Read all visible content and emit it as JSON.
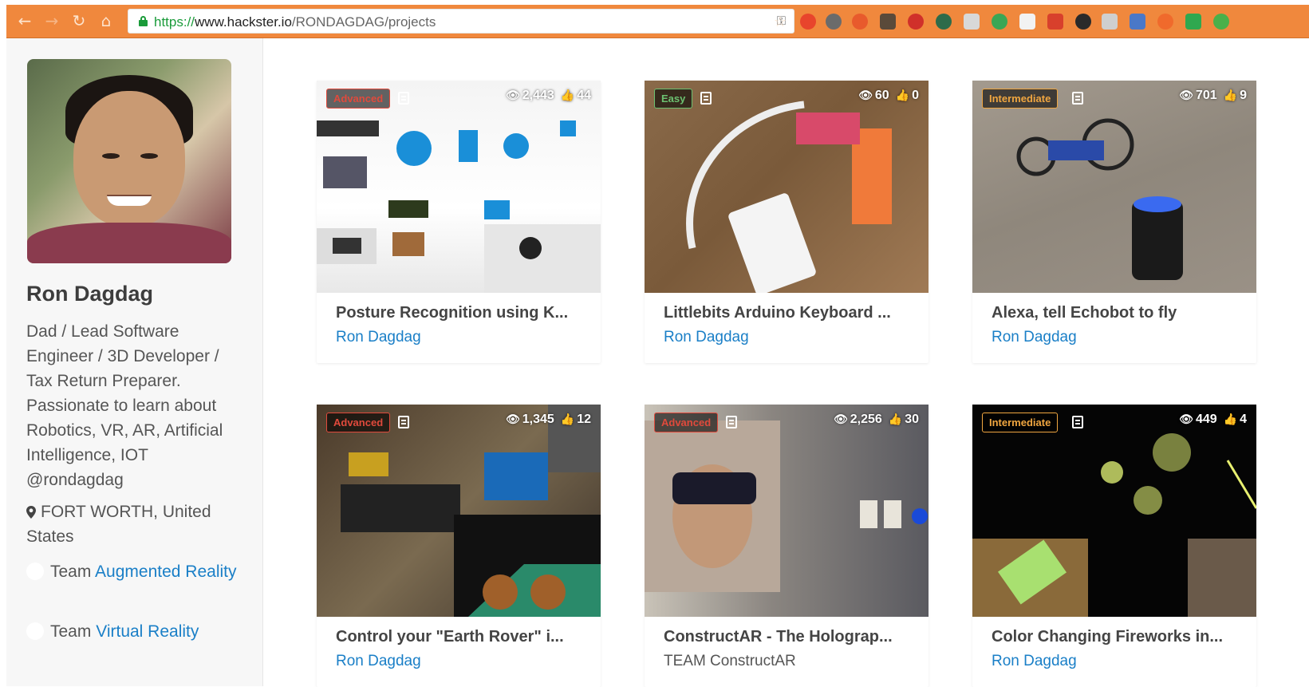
{
  "browser": {
    "url_scheme": "https://",
    "url_host": "www.hackster.io",
    "url_path": "/RONDAGDAG/projects",
    "accent": "#f0883d"
  },
  "profile": {
    "name": "Ron Dagdag",
    "bio": "Dad / Lead Software Engineer / 3D Developer / Tax Return Preparer. Passionate to learn about Robotics, VR, AR, Artificial Intelligence, IOT @rondagdag",
    "location": "FORT WORTH, United States",
    "teams": [
      {
        "prefix": "Team",
        "name": "Augmented Reality"
      },
      {
        "prefix": "Team",
        "name": "Virtual Reality"
      }
    ]
  },
  "projects": [
    {
      "badge": "Advanced",
      "views": "2,443",
      "likes": "44",
      "title": "Posture Recognition using K...",
      "author": "Ron Dagdag"
    },
    {
      "badge": "Easy",
      "views": "60",
      "likes": "0",
      "title": "Littlebits Arduino Keyboard ...",
      "author": "Ron Dagdag"
    },
    {
      "badge": "Intermediate",
      "views": "701",
      "likes": "9",
      "title": "Alexa, tell Echobot to fly",
      "author": "Ron Dagdag"
    },
    {
      "badge": "Advanced",
      "views": "1,345",
      "likes": "12",
      "title": "Control your \"Earth Rover\" i...",
      "author": "Ron Dagdag"
    },
    {
      "badge": "Advanced",
      "views": "2,256",
      "likes": "30",
      "title": "ConstructAR - The Holograp...",
      "author": "TEAM ConstructAR"
    },
    {
      "badge": "Intermediate",
      "views": "449",
      "likes": "4",
      "title": "Color Changing Fireworks in...",
      "author": "Ron Dagdag"
    }
  ]
}
